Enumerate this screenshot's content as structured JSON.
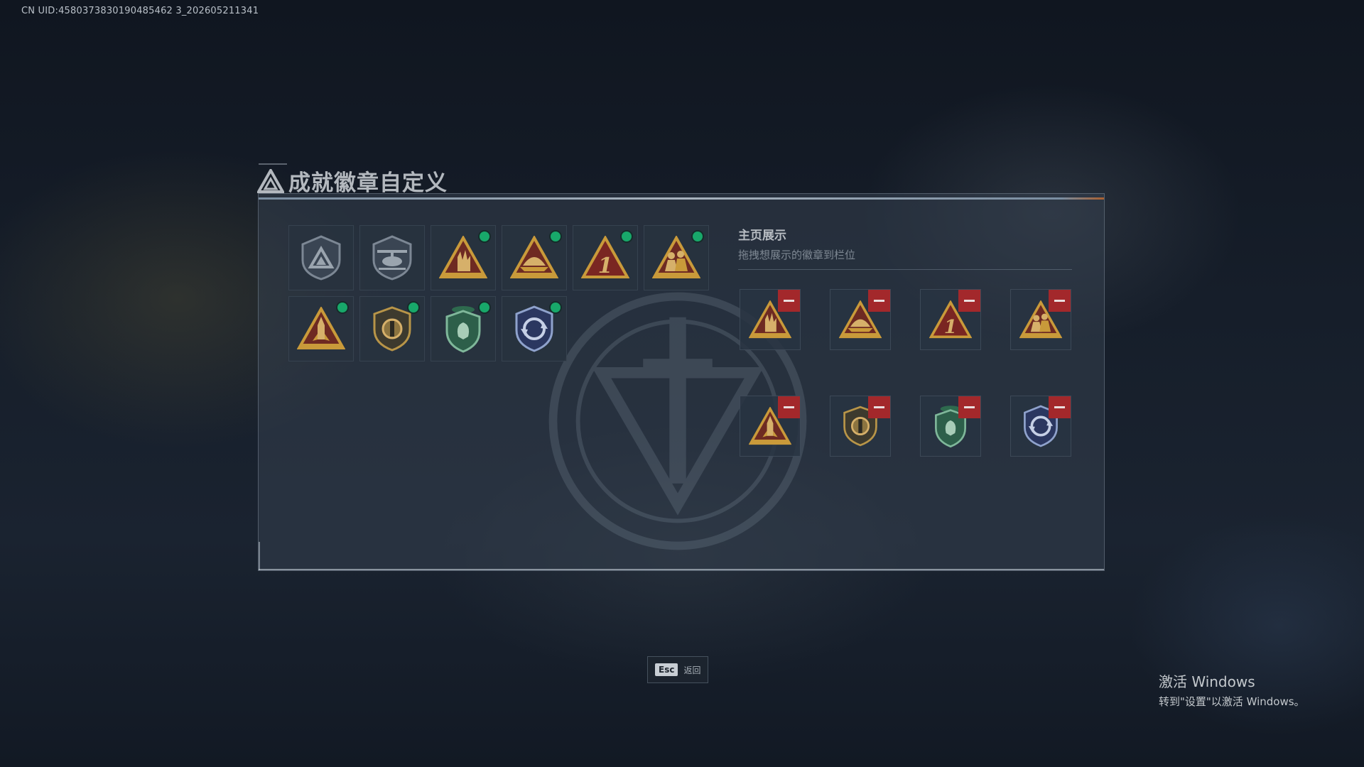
{
  "uid_text": "CN UID:4580373830190485462 3_202605211341",
  "page": {
    "title": "成就徽章自定义",
    "title_icon": "triangle-emblem-icon"
  },
  "owned_badges": [
    {
      "name": "shield-triangle-badge-icon",
      "equipped": false
    },
    {
      "name": "helicopter-badge-icon",
      "equipped": false
    },
    {
      "name": "hand-sign-badge-icon",
      "equipped": true
    },
    {
      "name": "boat-badge-icon",
      "equipped": true
    },
    {
      "name": "number-one-badge-icon",
      "equipped": true
    },
    {
      "name": "soldiers-badge-icon",
      "equipped": true
    },
    {
      "name": "rocket-badge-icon",
      "equipped": true
    },
    {
      "name": "round-shield-badge-icon",
      "equipped": true
    },
    {
      "name": "green-shield-badge-icon",
      "equipped": true
    },
    {
      "name": "blue-cycle-badge-icon",
      "equipped": true
    }
  ],
  "showcase": {
    "title": "主页展示",
    "subtitle": "拖拽想展示的徽章到栏位",
    "slots": [
      {
        "name": "hand-sign-badge-icon"
      },
      {
        "name": "boat-badge-icon"
      },
      {
        "name": "number-one-badge-icon"
      },
      {
        "name": "soldiers-badge-icon"
      },
      {
        "name": "rocket-badge-icon"
      },
      {
        "name": "round-shield-badge-icon"
      },
      {
        "name": "green-shield-badge-icon"
      },
      {
        "name": "blue-cycle-badge-icon"
      }
    ]
  },
  "footer": {
    "esc_key": "Esc",
    "esc_label": "返回"
  },
  "windows_activation": {
    "line1": "激活 Windows",
    "line2": "转到\"设置\"以激活 Windows。"
  },
  "colors": {
    "equipped_dot": "#18a86a",
    "remove_button": "#a3282b",
    "gold": "#c99a3a"
  }
}
